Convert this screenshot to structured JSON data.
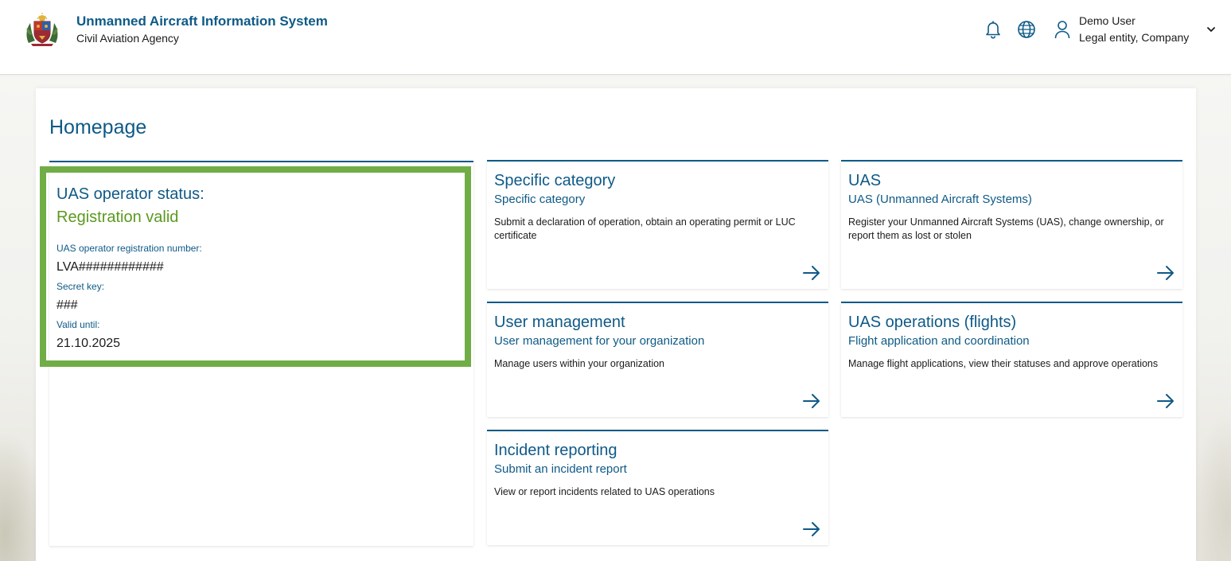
{
  "header": {
    "title": "Unmanned Aircraft Information System",
    "subtitle": "Civil Aviation Agency",
    "user_name": "Demo User",
    "user_entity": "Legal entity, Company"
  },
  "page": {
    "title": "Homepage"
  },
  "status": {
    "label": "UAS operator status:",
    "value": "Registration valid",
    "reg_label": "UAS operator registration number:",
    "reg_value": "LVA############",
    "key_label": "Secret key:",
    "key_value": "###",
    "valid_label": "Valid until:",
    "valid_value": "21.10.2025"
  },
  "cards": [
    {
      "title": "Specific category",
      "subtitle": "Specific category",
      "description": "Submit a declaration of operation, obtain an operating permit or LUC certificate"
    },
    {
      "title": "UAS",
      "subtitle": "UAS (Unmanned Aircraft Systems)",
      "description": "Register your Unmanned Aircraft Systems (UAS), change ownership, or report them as lost or stolen"
    },
    {
      "title": "User management",
      "subtitle": "User management for your organization",
      "description": "Manage users within your organization"
    },
    {
      "title": "UAS operations (flights)",
      "subtitle": "Flight application and coordination",
      "description": "Manage flight applications, view their statuses and approve operations"
    },
    {
      "title": "Incident reporting",
      "subtitle": "Submit an incident report",
      "description": "View or report incidents related to UAS operations"
    }
  ],
  "colors": {
    "primary": "#0e5a87",
    "success": "#5b9a1f",
    "highlight": "#70ad47"
  },
  "icons": [
    "coat-of-arms-logo",
    "bell-icon",
    "globe-icon",
    "user-icon",
    "chevron-down-icon",
    "arrow-right-icon"
  ]
}
